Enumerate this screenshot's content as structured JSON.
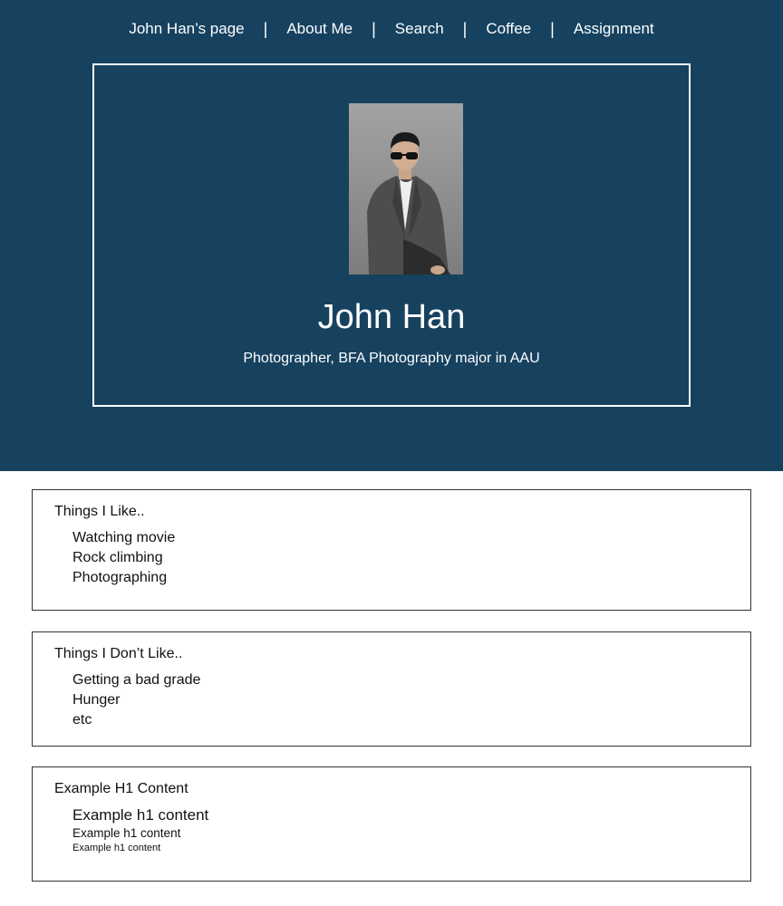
{
  "nav": {
    "items": [
      {
        "label": "John Han’s page"
      },
      {
        "label": "About Me"
      },
      {
        "label": "Search"
      },
      {
        "label": "Coffee"
      },
      {
        "label": "Assignment"
      }
    ],
    "separator": "|"
  },
  "profile": {
    "name": "John Han",
    "tagline": "Photographer, BFA Photography major in AAU",
    "photo_icon": "portrait-photo"
  },
  "sections": [
    {
      "title": "Things I Like..",
      "items": [
        "Watching movie",
        "Rock climbing",
        "Photographing"
      ]
    },
    {
      "title": "Things I Don’t Like..",
      "items": [
        "Getting a bad grade",
        "Hunger",
        "etc"
      ]
    },
    {
      "title": "Example H1 Content",
      "items": [
        "Example h1 content",
        "Example h1 content",
        "Example h1 content"
      ]
    }
  ],
  "colors": {
    "hero_background": "#16425f",
    "text_light": "#ffffff",
    "text_dark": "#111111"
  }
}
